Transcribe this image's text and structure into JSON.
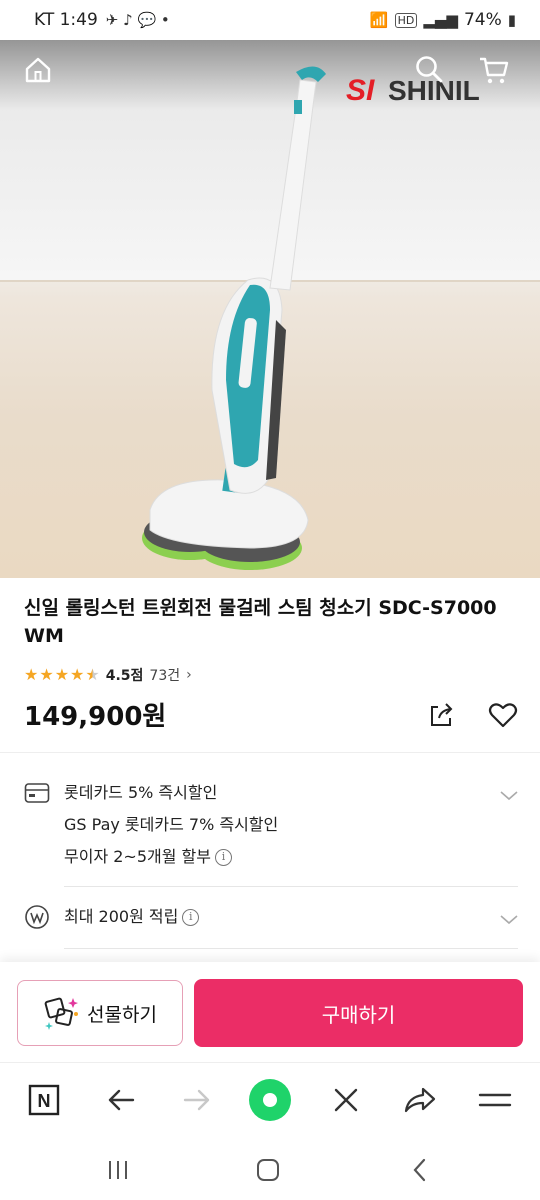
{
  "status_bar": {
    "carrier_time": "KT 1:49",
    "network": "HD",
    "battery": "74%"
  },
  "hero": {
    "brand_logo_text": "SHINIL",
    "icons": [
      "home-icon",
      "search-icon",
      "cart-icon"
    ]
  },
  "product": {
    "title": "신일 롤링스턴 트윈회전 물걸레 스팀 청소기 SDC-S7000 WM",
    "rating": 4.5,
    "rating_label": "4.5점",
    "review_count": "73건",
    "price": "149,900원"
  },
  "benefits": {
    "card_lines": [
      "롯데카드 5% 즉시할인",
      "GS Pay 롯데카드 7% 즉시할인",
      "무이자 2~5개월 할부"
    ],
    "points_label": "최대 200원 적립"
  },
  "actions": {
    "gift_label": "선물하기",
    "buy_label": "구매하기",
    "buy_color": "#eb2d66"
  },
  "browser_toolbar": {
    "items": [
      "naver-n-icon",
      "back-arrow-icon",
      "forward-arrow-icon",
      "green-circle-icon",
      "close-icon",
      "share-icon",
      "menu-icon"
    ],
    "naver_letter": "N"
  }
}
